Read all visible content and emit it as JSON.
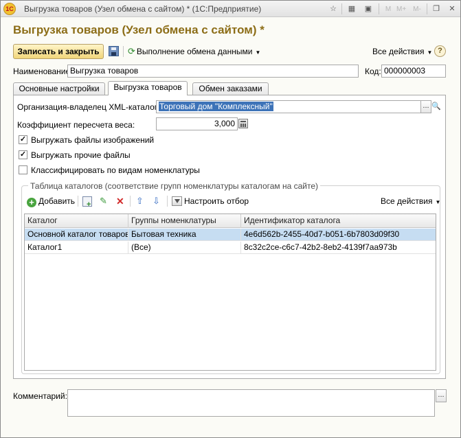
{
  "window": {
    "title": "Выгрузка товаров (Узел обмена с сайтом) * (1С:Предприятие)",
    "logo_text": "1С",
    "titlebar_buttons": [
      "M",
      "M+",
      "M-"
    ]
  },
  "form": {
    "title": "Выгрузка товаров (Узел обмена с сайтом) *"
  },
  "toolbar": {
    "save_close": "Записать и закрыть",
    "exchange": "Выполнение обмена данными",
    "all_actions": "Все действия",
    "help": "?"
  },
  "fields": {
    "name_label": "Наименование:",
    "name_value": "Выгрузка товаров",
    "code_label": "Код:",
    "code_value": "000000003"
  },
  "tabs": [
    {
      "label": "Основные настройки"
    },
    {
      "label": "Выгрузка товаров",
      "active": true
    },
    {
      "label": "Обмен заказами"
    }
  ],
  "export": {
    "org_label": "Организация-владелец XML-каталога:",
    "org_value": "Торговый дом \"Комплексный\"",
    "weight_label": "Коэффициент пересчета веса:",
    "weight_value": "3,000",
    "checkboxes": [
      {
        "label": "Выгружать файлы изображений",
        "checked": true
      },
      {
        "label": "Выгружать прочие файлы",
        "checked": true
      },
      {
        "label": "Классифицировать по видам номенклатуры",
        "checked": false
      }
    ]
  },
  "catalogs": {
    "title": "Таблица каталогов (соответствие групп номенклатуры каталогам на сайте)",
    "add": "Добавить",
    "filter": "Настроить отбор",
    "all_actions": "Все действия",
    "columns": [
      "Каталог",
      "Группы номенклатуры",
      "Идентификатор каталога"
    ],
    "rows": [
      {
        "catalog": "Основной каталог товаров",
        "group": "Бытовая техника",
        "id": "4e6d562b-2455-40d7-b051-6b7803d09f30",
        "selected": true
      },
      {
        "catalog": "Каталог1",
        "group": "(Все)",
        "id": "8c32c2ce-c6c7-42b2-8eb2-4139f7aa973b",
        "selected": false
      }
    ]
  },
  "comment": {
    "label": "Комментарий:",
    "value": ""
  },
  "colors": {
    "title_gold": "#8c6d17",
    "selection": "#c6ddf2",
    "primary_button": "#f1d67a"
  }
}
